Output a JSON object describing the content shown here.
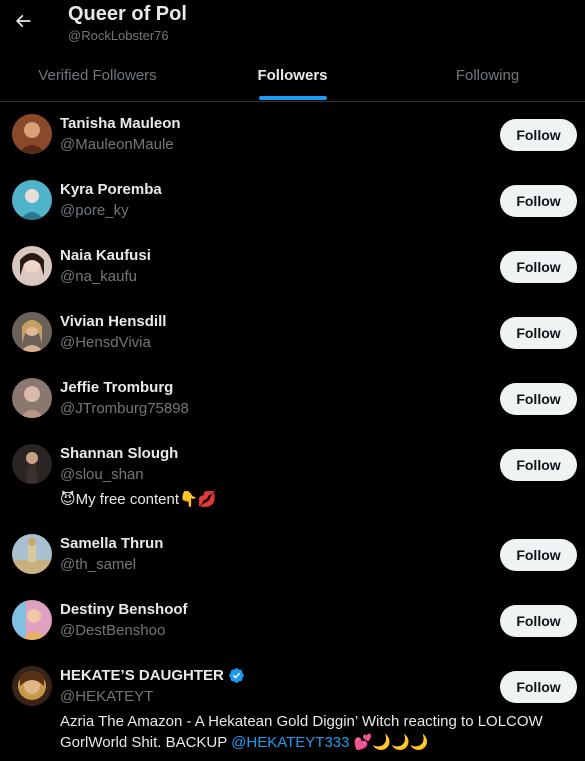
{
  "header": {
    "title": "Queer of Pol",
    "handle": "@RockLobster76"
  },
  "tabs": [
    {
      "label": "Verified Followers",
      "active": false
    },
    {
      "label": "Followers",
      "active": true
    },
    {
      "label": "Following",
      "active": false
    }
  ],
  "follow_label": "Follow",
  "users": [
    {
      "name": "Tanisha Mauleon",
      "handle": "@MauleonMaule"
    },
    {
      "name": "Kyra Poremba",
      "handle": "@pore_ky"
    },
    {
      "name": "Naia Kaufusi",
      "handle": "@na_kaufu"
    },
    {
      "name": "Vivian Hensdill",
      "handle": "@HensdVivia"
    },
    {
      "name": "Jeffie Tromburg",
      "handle": "@JTromburg75898"
    },
    {
      "name": "Shannan Slough",
      "handle": "@slou_shan",
      "bio": {
        "pre": "😈My free content👇💋"
      }
    },
    {
      "name": "Samella Thrun",
      "handle": "@th_samel"
    },
    {
      "name": "Destiny Benshoof",
      "handle": "@DestBenshoo"
    },
    {
      "name": "HEKATE’S DAUGHTER",
      "handle": "@HEKATEYT",
      "verified": true,
      "bio": {
        "pre": "Azria The Amazon - A Hekatean Gold Diggin’ Witch reacting to LOLCOW GorlWorld Shit. BACKUP ",
        "link": "@HEKATEYT333",
        "post": " 💕🌙🌙🌙"
      }
    }
  ],
  "colors": {
    "background": "#000000",
    "accent": "#1d9bf0",
    "muted": "#71767b",
    "button_bg": "#eff3f4"
  }
}
